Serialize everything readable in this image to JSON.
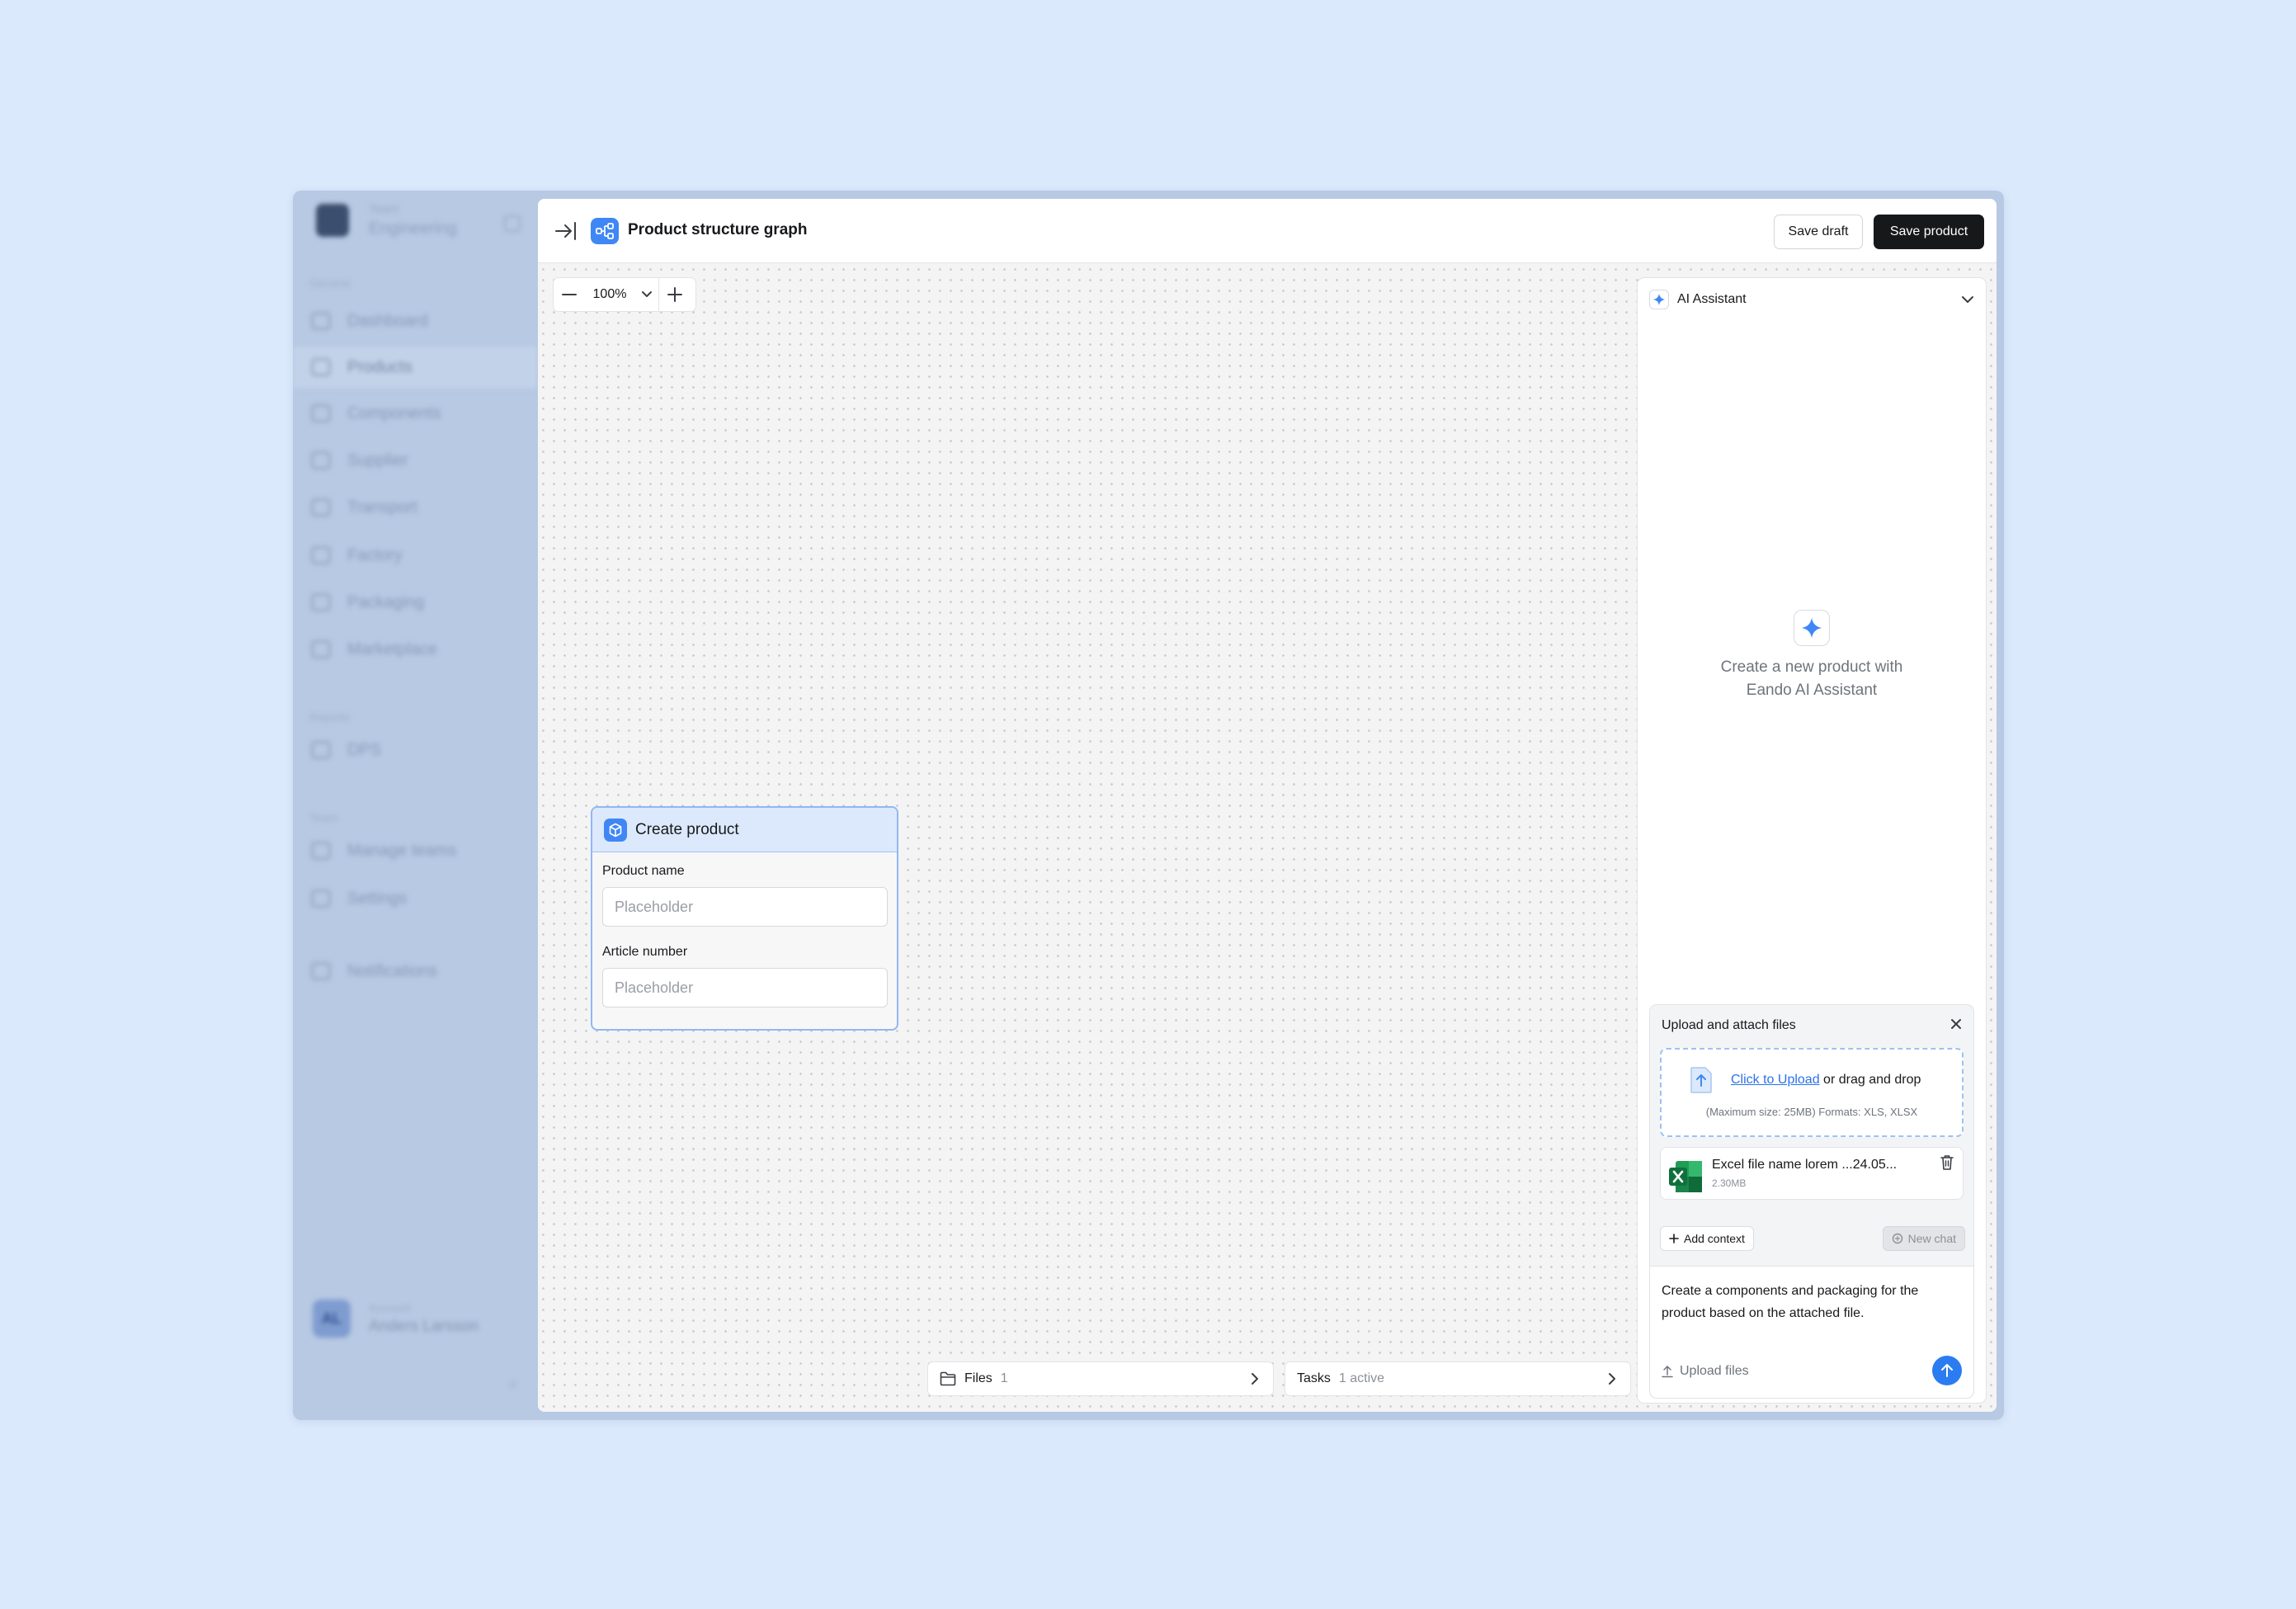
{
  "sidebar": {
    "workspace_small": "Team",
    "workspace_name": "Engineering",
    "section_general": "General",
    "items": [
      {
        "label": "Dashboard"
      },
      {
        "label": "Products"
      },
      {
        "label": "Components"
      },
      {
        "label": "Supplier"
      },
      {
        "label": "Transport"
      },
      {
        "label": "Factory"
      },
      {
        "label": "Packaging"
      },
      {
        "label": "Marketplace"
      }
    ],
    "section_reports": "Reports",
    "reports_items": [
      {
        "label": "DPS"
      }
    ],
    "section_team": "Team",
    "team_items": [
      {
        "label": "Manage teams"
      },
      {
        "label": "Settings"
      }
    ],
    "notifications": "Notifications",
    "user_initials": "AL",
    "user_small": "Account",
    "user_name": "Anders Larsson"
  },
  "topbar": {
    "title": "Product structure graph",
    "save_draft": "Save draft",
    "save_product": "Save product"
  },
  "zoom": {
    "value": "100%"
  },
  "node": {
    "title": "Create product",
    "product_name_label": "Product name",
    "product_name_placeholder": "Placeholder",
    "article_number_label": "Article number",
    "article_number_placeholder": "Placeholder"
  },
  "bottom": {
    "files_label": "Files",
    "files_count": "1",
    "tasks_label": "Tasks",
    "tasks_status": "1 active"
  },
  "ai": {
    "title": "AI Assistant",
    "empty_text": "Create a new product with Eando AI Assistant",
    "upload_title": "Upload and attach files",
    "click_to_upload": "Click to Upload",
    "drag_drop": " or drag and drop",
    "limits": "(Maximum size: 25MB) Formats: XLS, XLSX",
    "file_name": "Excel file name lorem ...24.05...",
    "file_size": "2.30MB",
    "add_context": "Add context",
    "new_chat": "New chat",
    "message": "Create a components and packaging for the product based on the attached file.",
    "upload_files": "Upload files"
  },
  "colors": {
    "page_bg": "#dbe9fc",
    "accent": "#3f87f5",
    "primary_button": "#17181a",
    "send_button": "#2b7cf0"
  }
}
